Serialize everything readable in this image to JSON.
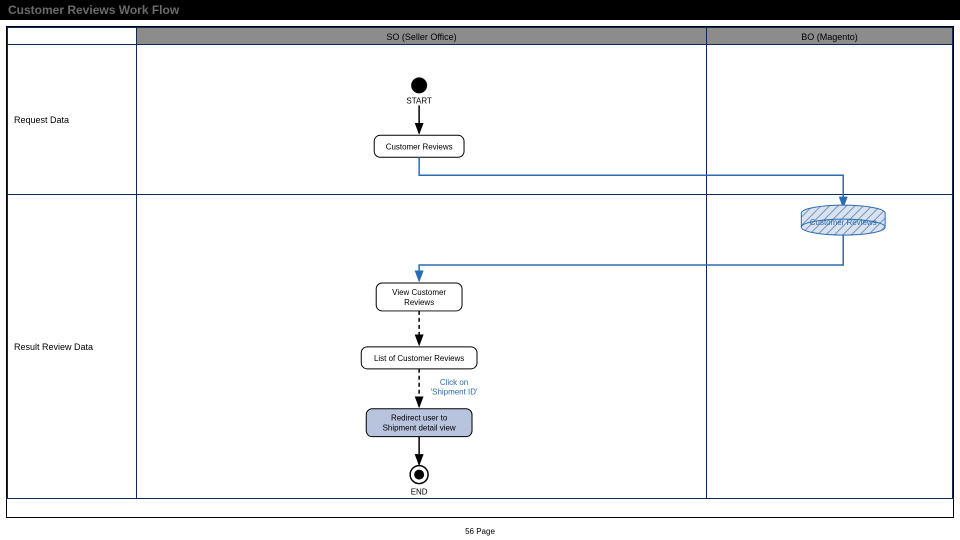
{
  "title": "Customer Reviews Work Flow",
  "columns": [
    "",
    "SO (Seller Office)",
    "BO (Magento)"
  ],
  "rows": [
    "Request Data",
    "Result Review Data"
  ],
  "nodes": {
    "start": "START",
    "end": "END",
    "cust_reviews": "Customer Reviews",
    "db_cust_reviews": "Customer Reviews",
    "view_reviews_l1": "View Customer",
    "view_reviews_l2": "Reviews",
    "list_reviews": "List of Customer Reviews",
    "click_l1": "Click on",
    "click_l2": "'Shipment ID'",
    "redirect_l1": "Redirect user to",
    "redirect_l2": "Shipment detail view"
  },
  "footer": "56 Page",
  "chart_data": {
    "type": "flowchart",
    "title": "Customer Reviews Work Flow",
    "swimlanes": {
      "columns": [
        "SO (Seller Office)",
        "BO (Magento)"
      ],
      "rows": [
        "Request Data",
        "Result Review Data"
      ]
    },
    "nodes": [
      {
        "id": "start",
        "type": "start",
        "label": "START",
        "lane_col": "SO (Seller Office)",
        "lane_row": "Request Data"
      },
      {
        "id": "cust_reviews",
        "type": "activity",
        "label": "Customer Reviews",
        "lane_col": "SO (Seller Office)",
        "lane_row": "Request Data"
      },
      {
        "id": "db",
        "type": "datastore",
        "label": "Customer Reviews",
        "lane_col": "BO (Magento)",
        "lane_row": "Result Review Data"
      },
      {
        "id": "view",
        "type": "activity",
        "label": "View Customer Reviews",
        "lane_col": "SO (Seller Office)",
        "lane_row": "Result Review Data"
      },
      {
        "id": "list",
        "type": "activity",
        "label": "List of Customer Reviews",
        "lane_col": "SO (Seller Office)",
        "lane_row": "Result Review Data"
      },
      {
        "id": "redirect",
        "type": "activity",
        "label": "Redirect user to Shipment detail view",
        "lane_col": "SO (Seller Office)",
        "lane_row": "Result Review Data",
        "highlight": true
      },
      {
        "id": "end",
        "type": "end",
        "label": "END",
        "lane_col": "SO (Seller Office)",
        "lane_row": "Result Review Data"
      }
    ],
    "edges": [
      {
        "from": "start",
        "to": "cust_reviews",
        "style": "solid"
      },
      {
        "from": "cust_reviews",
        "to": "db",
        "style": "solid",
        "color": "blue"
      },
      {
        "from": "db",
        "to": "view",
        "style": "solid",
        "color": "blue"
      },
      {
        "from": "view",
        "to": "list",
        "style": "dashed"
      },
      {
        "from": "list",
        "to": "redirect",
        "style": "dashed",
        "label": "Click on 'Shipment ID'"
      },
      {
        "from": "redirect",
        "to": "end",
        "style": "solid"
      }
    ]
  }
}
